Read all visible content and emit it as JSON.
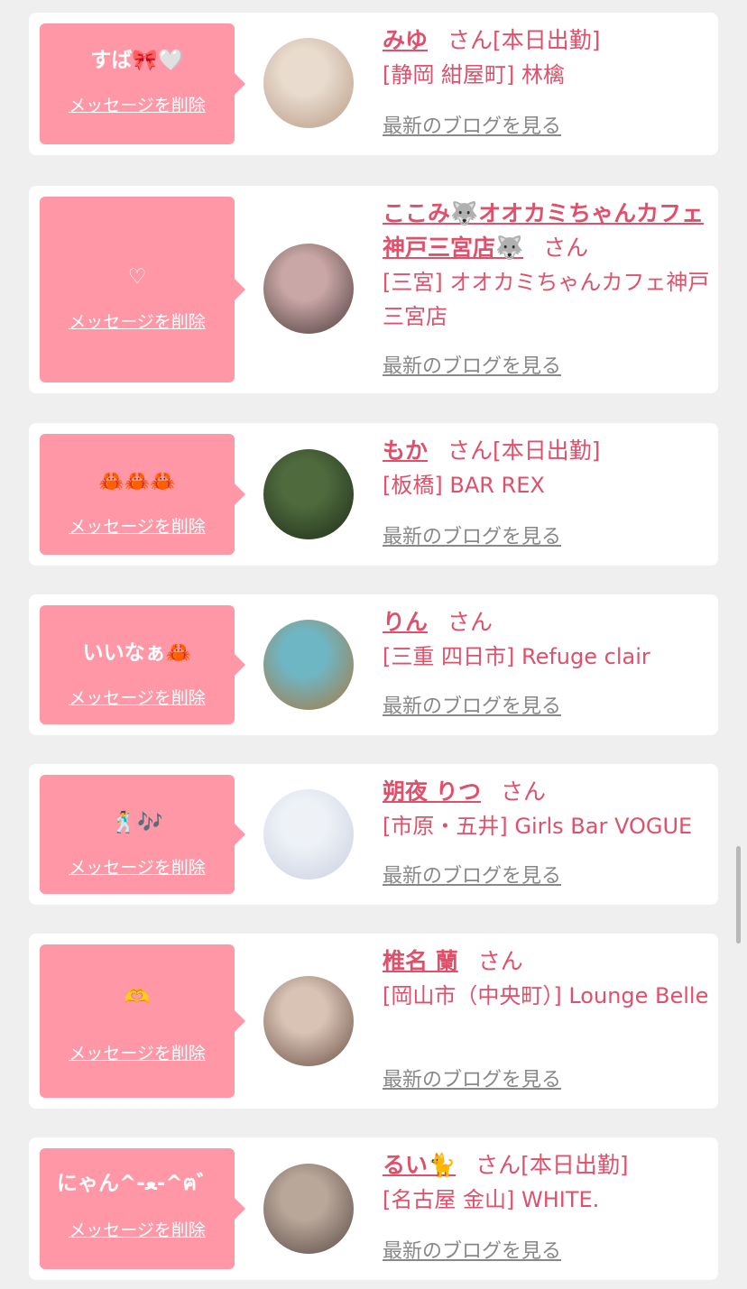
{
  "messages": [
    {
      "bubble_text": "すば🎀🤍",
      "delete_label": "メッセージを削除",
      "name": "みゆ",
      "honorific": "さん",
      "status": "[本日出勤]",
      "shop": "[静岡 紺屋町] 林檎",
      "blog_link": "最新のブログを見る",
      "avatar_colors": [
        "#e9dccf",
        "#b89a84"
      ]
    },
    {
      "bubble_text": "♡",
      "delete_label": "メッセージを削除",
      "name": "ここみ🐺オオカミちゃんカフェ神戸三宮店🐺",
      "honorific": "さん",
      "status": "",
      "shop": "[三宮] オオカミちゃんカフェ神戸三宮店",
      "blog_link": "最新のブログを見る",
      "avatar_colors": [
        "#c9a7a6",
        "#4b3a3a"
      ]
    },
    {
      "bubble_text": "🦀🦀🦀",
      "delete_label": "メッセージを削除",
      "name": "もか",
      "honorific": "さん",
      "status": "[本日出勤]",
      "shop": "[板橋] BAR REX",
      "blog_link": "最新のブログを見る",
      "avatar_colors": [
        "#4f6b3e",
        "#1e2c18"
      ]
    },
    {
      "bubble_text": "いいなぁ🦀",
      "delete_label": "メッセージを削除",
      "name": "りん",
      "honorific": "さん",
      "status": "",
      "shop": "[三重 四日市] Refuge clair",
      "blog_link": "最新のブログを見る",
      "avatar_colors": [
        "#6fb6c4",
        "#a8783f"
      ]
    },
    {
      "bubble_text": "🕺🎶",
      "delete_label": "メッセージを削除",
      "name": "朔夜 りつ",
      "honorific": "さん",
      "status": "",
      "shop": "[市原・五井] Girls Bar VOGUE",
      "blog_link": "最新のブログを見る",
      "avatar_colors": [
        "#eef2f7",
        "#c9cfe0"
      ]
    },
    {
      "bubble_text": "🫶",
      "delete_label": "メッセージを削除",
      "name": "椎名 蘭",
      "honorific": "さん",
      "status": "",
      "shop": "[岡山市（中央町）] Lounge Belle",
      "blog_link": "最新のブログを見る",
      "avatar_colors": [
        "#d8c3b4",
        "#6b4f45"
      ]
    },
    {
      "bubble_text": "にゃん^-ﻌ-^ฅ゛",
      "delete_label": "メッセージを削除",
      "name": "るい🐈",
      "honorific": "さん",
      "status": "[本日出勤]",
      "shop": "[名古屋 金山] WHITE.",
      "blog_link": "最新のブログを見る",
      "avatar_colors": [
        "#b9a79a",
        "#5a4a44"
      ]
    }
  ]
}
